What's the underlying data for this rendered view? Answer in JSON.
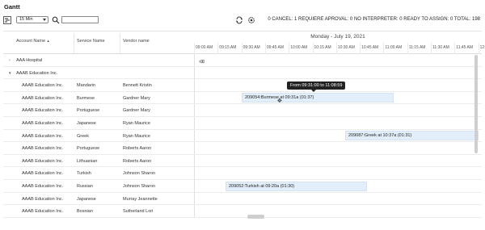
{
  "app": {
    "title": "Gantt"
  },
  "toolbar": {
    "interval_value": "15 Min",
    "search_placeholder": "",
    "status_text": "0 CANCEL: 1 REQUIERE APROVAL: 0 NO INTERPRETER: 0 READY TO ASSIGN: 0 TOTAL: 198"
  },
  "table": {
    "columns": [
      "Account Name",
      "Service Name",
      "Vendor name"
    ],
    "sort_indicator": "▲",
    "groups": [
      {
        "label": "AAA Hospital",
        "expanded": false
      },
      {
        "label": "AAAB Education Inc.",
        "expanded": true
      }
    ],
    "rows": [
      {
        "account": "AAAB Education Inc.",
        "service": "Mandarin",
        "vendor": "Bennett Kristin"
      },
      {
        "account": "AAAB Education Inc.",
        "service": "Burmese",
        "vendor": "Gardner Mary"
      },
      {
        "account": "AAAB Education Inc.",
        "service": "Portuguese",
        "vendor": "Gardner Mary"
      },
      {
        "account": "AAAB Education Inc.",
        "service": "Japanese",
        "vendor": "Ryan Maurice"
      },
      {
        "account": "AAAB Education Inc.",
        "service": "Greek",
        "vendor": "Ryan Maurice"
      },
      {
        "account": "AAAB Education Inc.",
        "service": "Portuguese",
        "vendor": "Roberts Aaron"
      },
      {
        "account": "AAAB Education Inc.",
        "service": "Lithuanian",
        "vendor": "Roberts Aaron"
      },
      {
        "account": "AAAB Education Inc.",
        "service": "Turkish",
        "vendor": "Johnson Sharon"
      },
      {
        "account": "AAAB Education Inc.",
        "service": "Russian",
        "vendor": "Johnson Sharon"
      },
      {
        "account": "AAAB Education Inc.",
        "service": "Japanese",
        "vendor": "Murray Jeannette"
      },
      {
        "account": "AAAB Education Inc.",
        "service": "Bosnian",
        "vendor": "Sutherland Lori"
      }
    ]
  },
  "timeline": {
    "date": "Monday - July 19, 2021",
    "ticks": [
      "09:00 AM",
      "09:15 AM",
      "09:30 AM",
      "09:45 AM",
      "10:00 AM",
      "10:15 AM",
      "10:30 AM",
      "10:45 AM",
      "11:00 AM",
      "11:15 AM",
      "11:30 AM",
      "11:45 AM",
      "12:0"
    ],
    "tasks": [
      {
        "label": "209054:Burmese at 09:31a (01:37)"
      },
      {
        "label": "209087:Greek at 10:37a (01:31)"
      },
      {
        "label": "209052:Turkish at 09:20a (01:30)"
      }
    ],
    "tooltip": "From 09:31:00 to 11:08:59"
  }
}
